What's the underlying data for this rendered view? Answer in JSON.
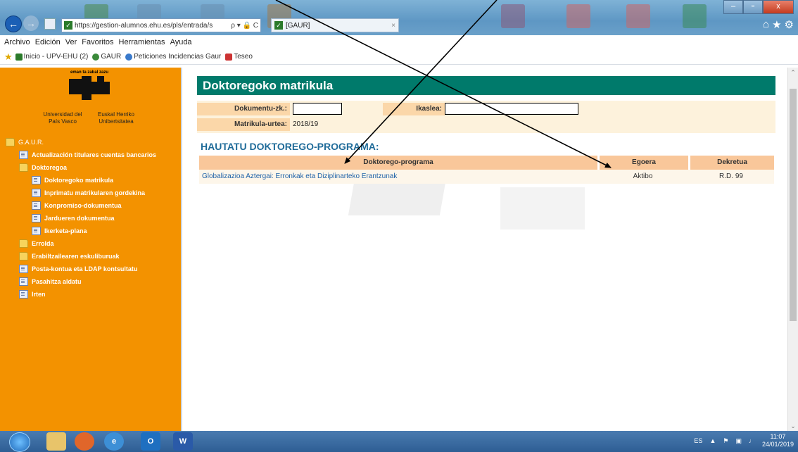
{
  "browser": {
    "url": "https://gestion-alumnos.ehu.es/pls/entrada/s",
    "url_controls": "ρ ▾ 🔒 C",
    "tab_label": "[GAUR]",
    "tab_close": "×",
    "window_buttons": [
      "–",
      "▫",
      "x"
    ],
    "toolbar_icons": [
      "⌂",
      "★",
      "⚙"
    ],
    "back_icon": "back-arrow-icon",
    "forward_icon": "forward-arrow-icon"
  },
  "menu": [
    "Archivo",
    "Edición",
    "Ver",
    "Favoritos",
    "Herramientas",
    "Ayuda"
  ],
  "favorites": [
    {
      "label": "Inicio - UPV-EHU (2)",
      "color": "#2a7a2a"
    },
    {
      "label": "GAUR",
      "color": "#3a8a3a"
    },
    {
      "label": "Peticiones Incidencias Gaur",
      "color": "#3a7acc"
    },
    {
      "label": "Teseo",
      "color": "#cc3333"
    }
  ],
  "logo": {
    "motto": "eman ta zabal zazu",
    "left_name": "Universidad del País Vasco",
    "right_name": "Euskal Herriko Unibertsitatea"
  },
  "sidebar": {
    "items": [
      {
        "label": "G.A.U.R.",
        "icon": "folder-icon",
        "level": 0
      },
      {
        "label": "Actualización titulares cuentas bancarios",
        "icon": "document-icon",
        "level": 1
      },
      {
        "label": "Doktoregoa",
        "icon": "folder-icon",
        "level": 1
      },
      {
        "label": "Doktoregoko matrikula",
        "icon": "document-icon",
        "level": 2
      },
      {
        "label": "Inprimatu matrikularen gordekina",
        "icon": "document-icon",
        "level": 2
      },
      {
        "label": "Konpromiso-dokumentua",
        "icon": "document-icon",
        "level": 2
      },
      {
        "label": "Jardueren dokumentua",
        "icon": "document-icon",
        "level": 2
      },
      {
        "label": "Ikerketa-plana",
        "icon": "document-icon",
        "level": 2
      },
      {
        "label": "Errolda",
        "icon": "folder-icon",
        "level": 1
      },
      {
        "label": "Erabiltzailearen eskuliburuak",
        "icon": "folder-icon",
        "level": 1
      },
      {
        "label": "Posta-kontua eta LDAP kontsultatu",
        "icon": "document-icon",
        "level": 1
      },
      {
        "label": "Pasahitza aldatu",
        "icon": "document-icon",
        "level": 1
      },
      {
        "label": "Irten",
        "icon": "document-icon",
        "level": 1
      }
    ]
  },
  "main": {
    "title": "Doktoregoko matrikula",
    "dokumentu_label": "Dokumentu-zk.:",
    "ikaslea_label": "Ikaslea:",
    "matrikula_label": "Matrikula-urtea:",
    "matrikula_value": "2018/19",
    "section_title": "HAUTATU DOKTOREGO-PROGRAMA:",
    "table": {
      "headers": [
        "Doktorego-programa",
        "Egoera",
        "Dekretua"
      ],
      "rows": [
        [
          "Globalizazioa Aztergai: Erronkak eta Diziplinarteko Erantzunak",
          "Aktibo",
          "R.D. 99"
        ]
      ]
    }
  },
  "taskbar": {
    "apps": [
      "start-orb",
      "file-explorer-icon",
      "firefox-icon",
      "internet-explorer-icon",
      "outlook-icon",
      "word-icon"
    ],
    "language": "ES",
    "time": "11:07",
    "date": "24/01/2019"
  },
  "colors": {
    "sidebar": "#f39200",
    "title_bar": "#007a6b",
    "section_title": "#1f6b99",
    "table_header": "#f9c79a"
  }
}
